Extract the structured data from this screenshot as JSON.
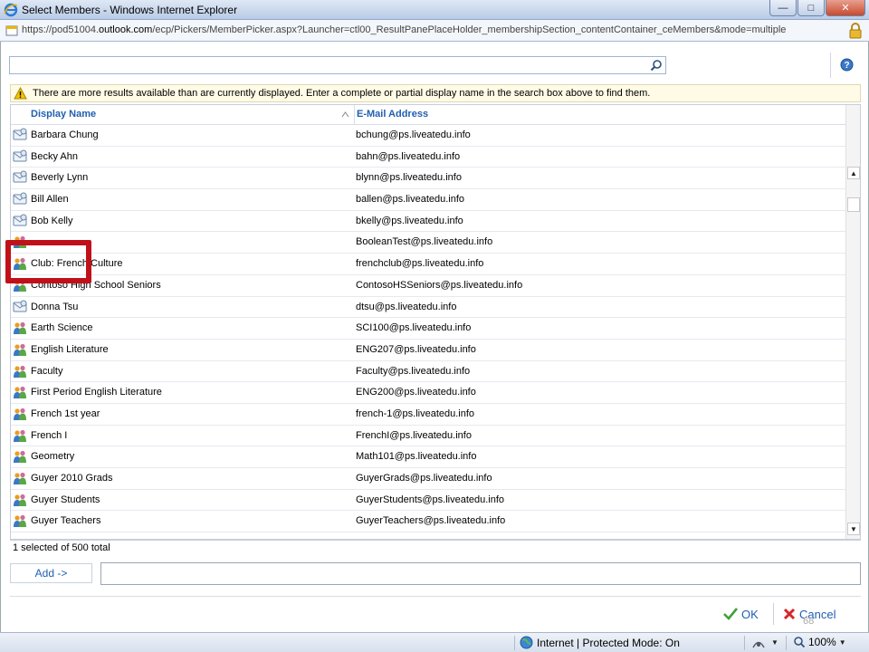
{
  "window": {
    "title": "Select Members - Windows Internet Explorer",
    "minimize_icon": "minimize-icon",
    "maximize_icon": "maximize-icon",
    "close_icon": "close-icon"
  },
  "address": {
    "prefix": "https://pod51004.",
    "domain": "outlook.com",
    "path": "/ecp/Pickers/MemberPicker.aspx?Launcher=ctl00_ResultPanePlaceHolder_membershipSection_contentContainer_ceMembers&mode=multiple"
  },
  "search": {
    "value": "",
    "placeholder": ""
  },
  "warning": {
    "text": "There are more results available than are currently displayed. Enter a complete or partial display name in the search box above to find them."
  },
  "grid": {
    "columns": {
      "display_name": "Display Name",
      "email": "E-Mail Address"
    },
    "rows": [
      {
        "name": "Barbara Chung",
        "email": "bchung@ps.liveatedu.info",
        "type": "user"
      },
      {
        "name": "Becky Ahn",
        "email": "bahn@ps.liveatedu.info",
        "type": "user"
      },
      {
        "name": "Beverly Lynn",
        "email": "blynn@ps.liveatedu.info",
        "type": "user"
      },
      {
        "name": "Bill Allen",
        "email": "ballen@ps.liveatedu.info",
        "type": "user"
      },
      {
        "name": "Bob Kelly",
        "email": "bkelly@ps.liveatedu.info",
        "type": "user"
      },
      {
        "name": "",
        "email": "BooleanTest@ps.liveatedu.info",
        "type": "group"
      },
      {
        "name": "Club: French Culture",
        "email": "frenchclub@ps.liveatedu.info",
        "type": "group"
      },
      {
        "name": "Contoso High School Seniors",
        "email": "ContosoHSSeniors@ps.liveatedu.info",
        "type": "group"
      },
      {
        "name": "Donna Tsu",
        "email": "dtsu@ps.liveatedu.info",
        "type": "user"
      },
      {
        "name": "Earth Science",
        "email": "SCI100@ps.liveatedu.info",
        "type": "group"
      },
      {
        "name": "English Literature",
        "email": "ENG207@ps.liveatedu.info",
        "type": "group"
      },
      {
        "name": "Faculty",
        "email": "Faculty@ps.liveatedu.info",
        "type": "group"
      },
      {
        "name": "First Period English Literature",
        "email": "ENG200@ps.liveatedu.info",
        "type": "group"
      },
      {
        "name": "French 1st year",
        "email": "french-1@ps.liveatedu.info",
        "type": "group"
      },
      {
        "name": "French I",
        "email": "FrenchI@ps.liveatedu.info",
        "type": "group"
      },
      {
        "name": "Geometry",
        "email": "Math101@ps.liveatedu.info",
        "type": "group"
      },
      {
        "name": "Guyer 2010 Grads",
        "email": "GuyerGrads@ps.liveatedu.info",
        "type": "group"
      },
      {
        "name": "Guyer Students",
        "email": "GuyerStudents@ps.liveatedu.info",
        "type": "group"
      },
      {
        "name": "Guyer Teachers",
        "email": "GuyerTeachers@ps.liveatedu.info",
        "type": "group"
      }
    ]
  },
  "status": {
    "selection": "1 selected of 500 total"
  },
  "actions": {
    "add_label": "Add ->",
    "ok_label": "OK",
    "cancel_label": "Cancel"
  },
  "slide_number": "68",
  "statusbar": {
    "zone": "Internet | Protected Mode: On",
    "zoom": "100%"
  },
  "colors": {
    "link_blue": "#1f5fb0",
    "highlight_red": "#c0111b",
    "warning_bg": "#fffbe6"
  }
}
